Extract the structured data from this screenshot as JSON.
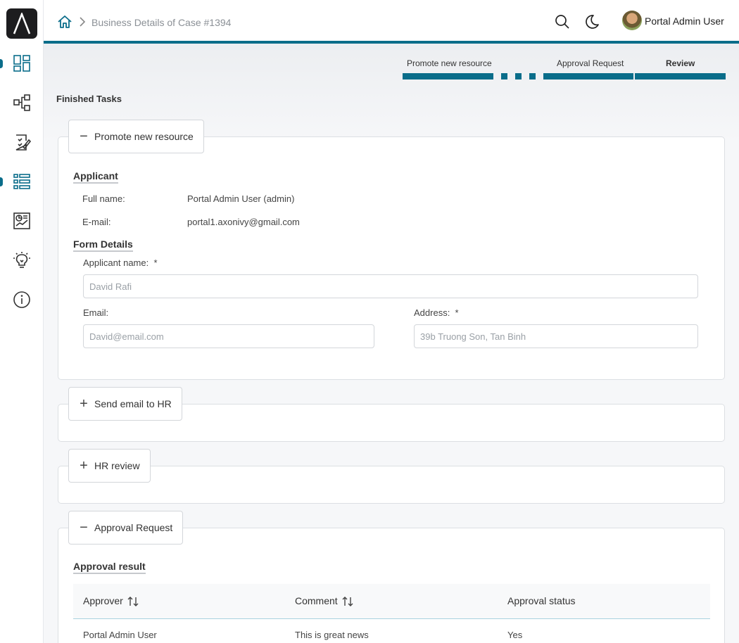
{
  "header": {
    "breadcrumb": "Business Details of Case #1394",
    "user_name": "Portal Admin User"
  },
  "sidebar": {
    "items": [
      {
        "icon": "dashboard-icon",
        "active": true
      },
      {
        "icon": "process-icon",
        "active": false
      },
      {
        "icon": "tasks-icon",
        "active": false
      },
      {
        "icon": "cases-icon",
        "active": true
      },
      {
        "icon": "statistics-icon",
        "active": false
      },
      {
        "icon": "idea-icon",
        "active": false
      },
      {
        "icon": "info-icon",
        "active": false
      }
    ]
  },
  "stepper": {
    "steps": [
      "Promote new resource",
      "Approval Request",
      "Review"
    ],
    "current": "Review"
  },
  "finished_tasks_title": "Finished Tasks",
  "panels": {
    "promote": {
      "toggle_label": "Promote new resource",
      "expanded": true,
      "applicant_title": "Applicant",
      "full_name_label": "Full name:",
      "full_name_value": "Portal Admin User (admin)",
      "email_label": "E-mail:",
      "email_value": "portal1.axonivy@gmail.com",
      "form_details_title": "Form Details",
      "applicant_name_label": "Applicant name:  *",
      "applicant_name_value": "David Rafi",
      "form_email_label": "Email:",
      "form_email_value": "David@email.com",
      "address_label": "Address:  *",
      "address_value": "39b Truong Son, Tan Binh"
    },
    "send_email": {
      "toggle_label": "Send email to HR",
      "expanded": false
    },
    "hr_review": {
      "toggle_label": "HR review",
      "expanded": false
    },
    "approval": {
      "toggle_label": "Approval Request",
      "expanded": true,
      "result_title": "Approval result",
      "columns": [
        "Approver",
        "Comment",
        "Approval status"
      ],
      "rows": [
        {
          "approver": "Portal Admin User",
          "comment": "This is great news",
          "status": "Yes"
        }
      ]
    }
  },
  "colors": {
    "accent": "#0a6d8a"
  }
}
